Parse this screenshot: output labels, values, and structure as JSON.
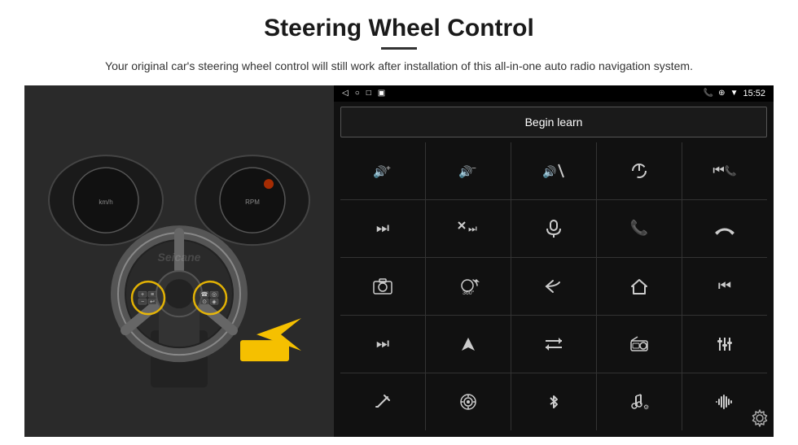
{
  "page": {
    "title": "Steering Wheel Control",
    "subtitle": "Your original car's steering wheel control will still work after installation of this all-in-one auto radio navigation system.",
    "divider": true
  },
  "statusBar": {
    "left": [
      "◁",
      "○",
      "□",
      "▣"
    ],
    "time": "15:52",
    "icons": [
      "📞",
      "⊕",
      "▼"
    ]
  },
  "beginLearn": {
    "label": "Begin learn"
  },
  "iconGrid": [
    {
      "icon": "🔊+",
      "symbol": "vol_up"
    },
    {
      "icon": "🔊−",
      "symbol": "vol_down"
    },
    {
      "icon": "🔊×",
      "symbol": "mute"
    },
    {
      "icon": "⏻",
      "symbol": "power"
    },
    {
      "icon": "⏮",
      "symbol": "prev_track_phone"
    },
    {
      "icon": "⏭",
      "symbol": "next"
    },
    {
      "icon": "⏭✗",
      "symbol": "skip"
    },
    {
      "icon": "🎤",
      "symbol": "mic"
    },
    {
      "icon": "📞",
      "symbol": "phone"
    },
    {
      "icon": "📞↙",
      "symbol": "hang_up"
    },
    {
      "icon": "📷",
      "symbol": "camera"
    },
    {
      "icon": "🔄360",
      "symbol": "rotate"
    },
    {
      "icon": "↩",
      "symbol": "back"
    },
    {
      "icon": "⌂",
      "symbol": "home"
    },
    {
      "icon": "⏮⏮",
      "symbol": "prev_track"
    },
    {
      "icon": "⏭⏭",
      "symbol": "fast_forward"
    },
    {
      "icon": "▶",
      "symbol": "navigate"
    },
    {
      "icon": "⇌",
      "symbol": "switch"
    },
    {
      "icon": "📻",
      "symbol": "radio"
    },
    {
      "icon": "⚙",
      "symbol": "settings_eq"
    },
    {
      "icon": "✏",
      "symbol": "edit"
    },
    {
      "icon": "🎯",
      "symbol": "target"
    },
    {
      "icon": "✱",
      "symbol": "bluetooth"
    },
    {
      "icon": "🎵",
      "symbol": "music"
    },
    {
      "icon": "|||",
      "symbol": "equalizer"
    }
  ],
  "gear": {
    "symbol": "⚙",
    "label": "settings"
  },
  "watermark": "Seicane",
  "colors": {
    "screenBg": "#111111",
    "cellBg": "#111111",
    "gridLine": "#333333",
    "statusBg": "#000000",
    "iconColor": "#cccccc",
    "buttonBorder": "#555555"
  }
}
